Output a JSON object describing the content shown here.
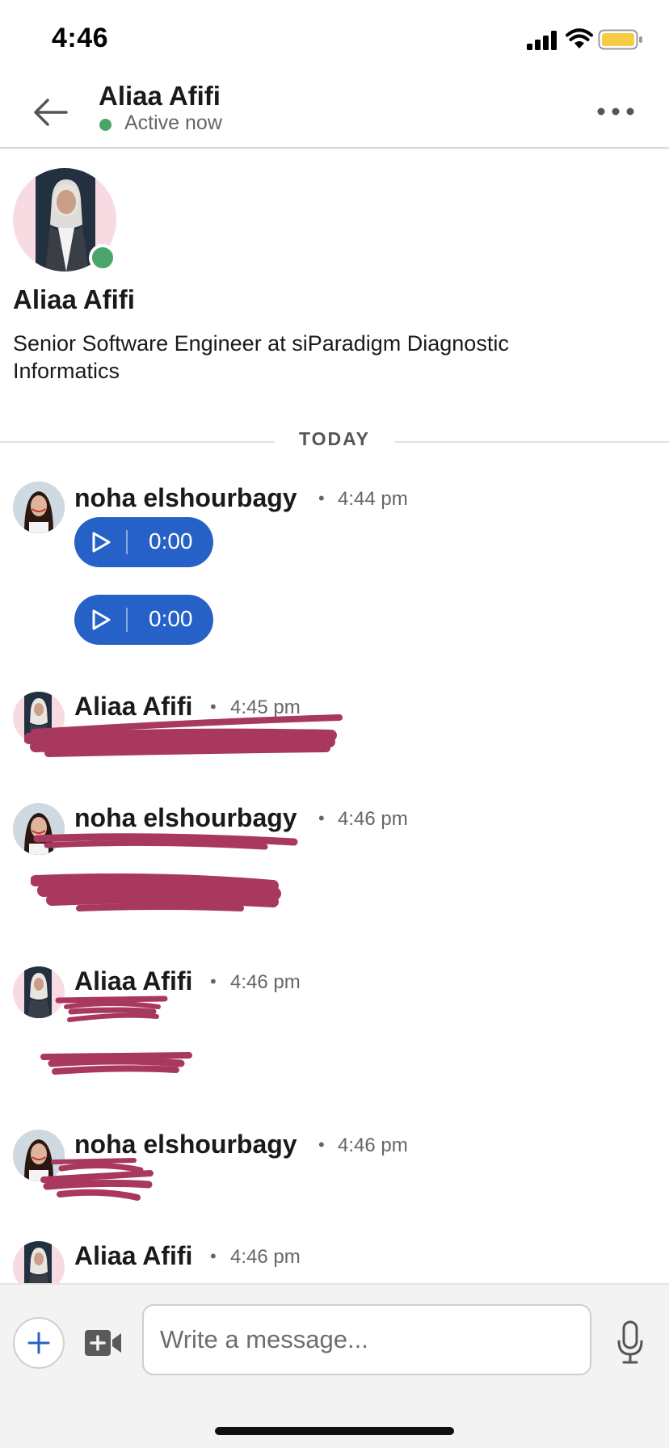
{
  "status_bar": {
    "time": "4:46",
    "icons": [
      "signal-icon",
      "wifi-icon",
      "battery-icon"
    ],
    "battery_color": "#f5cd45"
  },
  "header": {
    "name": "Aliaa Afifi",
    "status": "Active now",
    "status_color": "#4aa56a",
    "icons": [
      "back-arrow-icon",
      "more-options-icon"
    ]
  },
  "profile": {
    "name": "Aliaa Afifi",
    "headline": "Senior Software Engineer at siParadigm Diagnostic Informatics",
    "online": true
  },
  "divider": {
    "label": "TODAY"
  },
  "messages": [
    {
      "sender": "noha elshourbagy",
      "separator": "•",
      "time": "4:44 pm",
      "voice_notes": [
        {
          "duration": "0:00"
        },
        {
          "duration": "0:00"
        }
      ]
    },
    {
      "sender": "Aliaa Afifi",
      "separator": "•",
      "time": "4:45 pm",
      "content": "redacted"
    },
    {
      "sender": "noha elshourbagy",
      "separator": "•",
      "time": "4:46 pm",
      "content": "redacted"
    },
    {
      "sender": "Aliaa Afifi",
      "separator": "•",
      "time": "4:46 pm",
      "content": "redacted"
    },
    {
      "sender": "noha elshourbagy",
      "separator": "•",
      "time": "4:46 pm",
      "content": "redacted"
    },
    {
      "sender": "Aliaa Afifi",
      "separator": "•",
      "time": "4:46 pm"
    }
  ],
  "colors": {
    "voice_note": "#2661c7",
    "redaction": "#a8385d",
    "online": "#4aa56a"
  },
  "composer": {
    "placeholder": "Write a message...",
    "icons": [
      "plus-icon",
      "video-icon",
      "microphone-icon"
    ]
  }
}
